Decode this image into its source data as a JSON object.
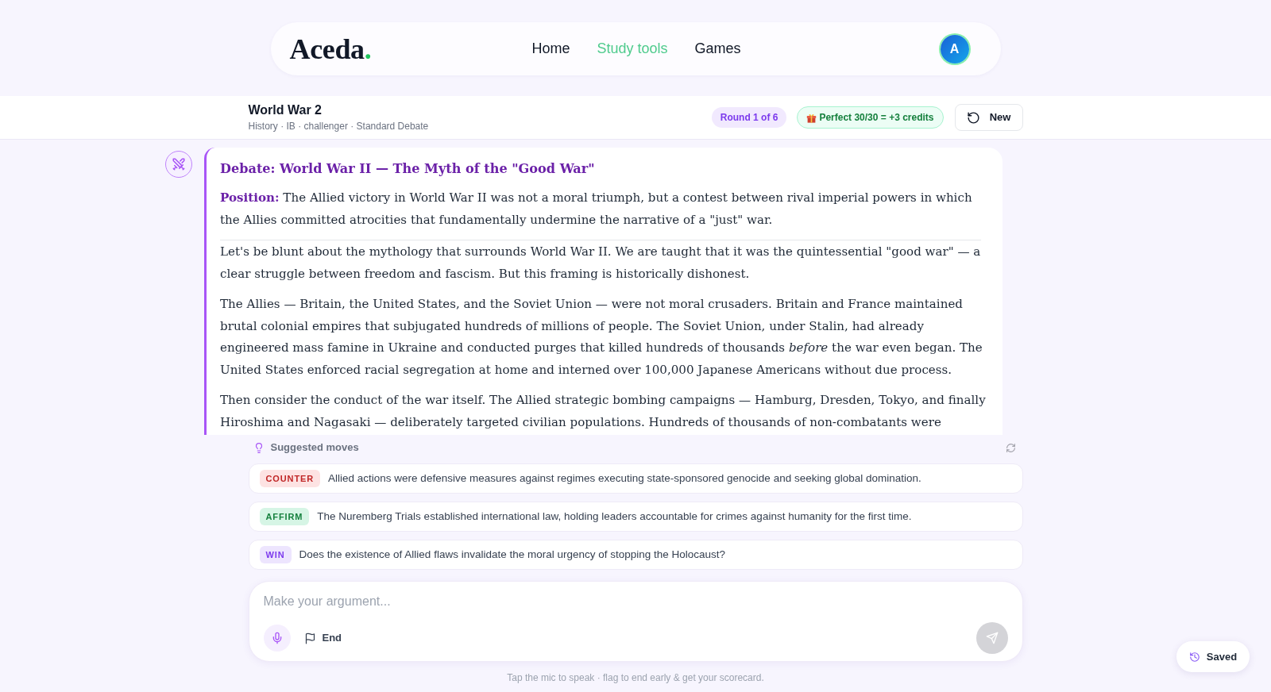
{
  "header": {
    "logo": {
      "text": "Aceda",
      "dot": "."
    },
    "nav": [
      {
        "label": "Home",
        "selected": false
      },
      {
        "label": "Study tools",
        "selected": true
      },
      {
        "label": "Games",
        "selected": false
      }
    ],
    "avatar": {
      "initial": "A"
    }
  },
  "session": {
    "title": "World War 2",
    "meta": "History · IB · challenger · Standard Debate",
    "round": "Round 1 of 6",
    "reward": "Perfect 30/30 = +3 credits",
    "new_button": "New"
  },
  "message": {
    "title": "Debate: World War II — The Myth of the \"Good War\"",
    "position": "**Position:** The Allied victory in World War II was not a moral triumph, but a contest between rival imperial powers in which the Allies committed atrocities that fundamentally undermine the narrative of a \"just\" war.",
    "paragraphs": [
      "Let's be blunt about the mythology that surrounds World War II. We are taught that it was the quintessential \"good war\" — a clear struggle between freedom and fascism. But this framing is historically dishonest.",
      "The Allies — Britain, the United States, and the Soviet Union — were not moral crusaders. Britain and France maintained brutal colonial empires that subjugated hundreds of millions of people. The Soviet Union, under Stalin, had already engineered mass famine in Ukraine and conducted purges that killed hundreds of thousands *before* the war even began. The United States enforced racial segregation at home and interned over 100,000 Japanese Americans without due process.",
      "Then consider the conduct of the war itself. The Allied strategic bombing campaigns — Hamburg, Dresden, Tokyo, and finally Hiroshima and Nagasaki — deliberately targeted civilian populations. Hundreds of thousands of non-combatants were"
    ]
  },
  "suggestions": {
    "label": "Suggested moves",
    "moves": [
      {
        "kind": "counter",
        "tag": "COUNTER",
        "text": "Allied actions were defensive measures against regimes executing state-sponsored genocide and seeking global domination."
      },
      {
        "kind": "affirm",
        "tag": "AFFIRM",
        "text": "The Nuremberg Trials established international law, holding leaders accountable for crimes against humanity for the first time."
      },
      {
        "kind": "win",
        "tag": "WIN",
        "text": "Does the existence of Allied flaws invalidate the moral urgency of stopping the Holocaust?"
      }
    ]
  },
  "composer": {
    "placeholder": "Make your argument...",
    "end_button": "End",
    "send_button": {
      "disabled": true
    },
    "hint": "Tap the mic to speak · flag to end early & get your scorecard."
  },
  "saved_button": "Saved"
}
